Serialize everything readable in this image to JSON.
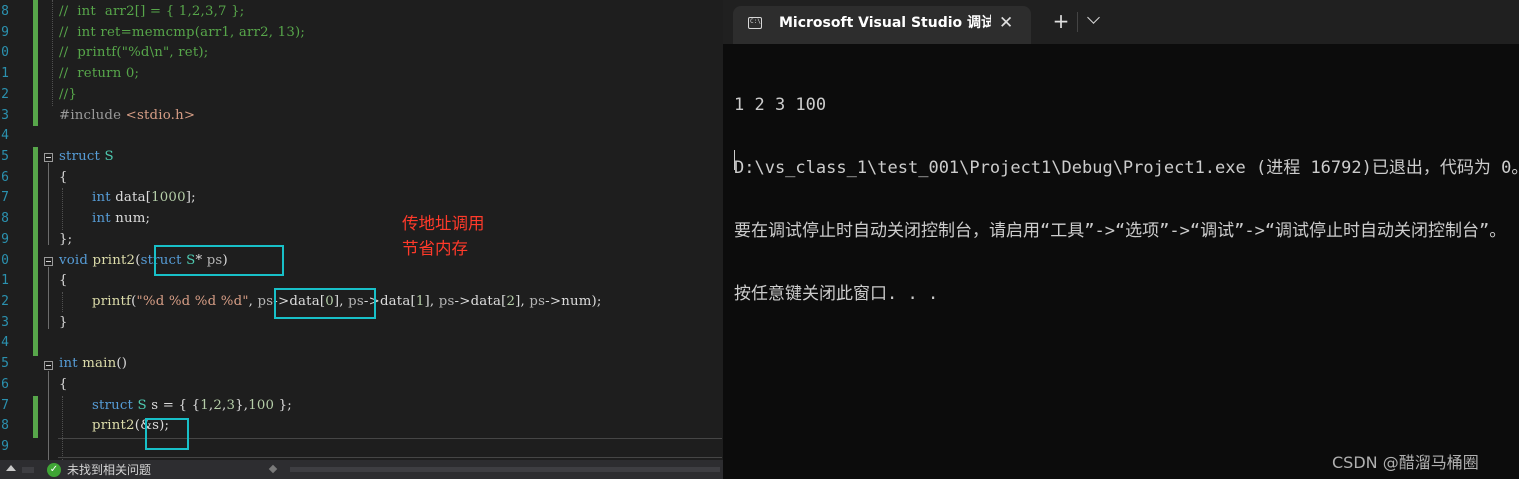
{
  "editor": {
    "line_numbers": [
      "8",
      "9",
      "0",
      "1",
      "2",
      "3",
      "4",
      "5",
      "6",
      "7",
      "8",
      "9",
      "0",
      "1",
      "2",
      "3",
      "4",
      "5",
      "6",
      "7",
      "8",
      "9"
    ],
    "lines": {
      "l0": {
        "a": "//  int  arr2[] = { 1,2,3,7 };"
      },
      "l1": {
        "a": "//  int ret=memcmp(arr1, arr2, 13);"
      },
      "l2": {
        "a": "//  printf(\"%d\\n\", ret);"
      },
      "l3": {
        "a": "//  return 0;"
      },
      "l4": {
        "a": "//}"
      },
      "l5": {
        "a": "#include ",
        "b": "<stdio.h>"
      },
      "l7": {
        "a": "struct ",
        "b": "S"
      },
      "l8": {
        "a": "{"
      },
      "l9": {
        "a": "int ",
        "b": "data",
        "c": "[",
        "d": "1000",
        "e": "];"
      },
      "l10": {
        "a": "int ",
        "b": "num",
        ";": ";"
      },
      "l11": {
        "a": "};"
      },
      "l12": {
        "a": "void ",
        "b": "print2",
        "c": "(",
        "d": "struct ",
        "e": "S",
        "f": "* ",
        "g": "ps",
        ")": ")"
      },
      "l13": {
        "a": "{"
      },
      "l14": {
        "a": "printf",
        "b": "(",
        "c": "\"%d %d %d %d\"",
        ",": ", ",
        "d": "ps",
        "e": "->",
        "f": "data",
        "g": "[",
        "h": "0",
        "i": "], ",
        "j": "ps",
        "k": "->",
        "l": "data",
        "m": "[",
        "n": "1",
        "o": "], ",
        "p": "ps",
        "q": "->",
        "r": "data",
        "s": "[",
        "t": "2",
        "u": "], ",
        "v": "ps",
        "w": "->",
        "x": "num",
        "y": ");"
      },
      "l15": {
        "a": "}"
      },
      "l17": {
        "a": "int ",
        "b": "main",
        "c": "()"
      },
      "l18": {
        "a": "{"
      },
      "l19": {
        "a": "struct ",
        "b": "S ",
        "c": "s",
        " =": " = { {",
        "d": "1",
        ",1": ",",
        "e": "2",
        ",2": ",",
        "f": "3",
        "g": "},",
        "h": "100",
        "i": " };"
      },
      "l20": {
        "a": "print2",
        "b": "(",
        "c": "&s",
        "d": ");"
      }
    },
    "annotation_line1": "传地址调用",
    "annotation_line2": "节省内存",
    "status_text": "未找到相关问题"
  },
  "terminal": {
    "tab_title": "Microsoft Visual Studio 调试控制台",
    "tab_close": "✕",
    "new_tab": "+",
    "lines": [
      "1 2 3 100",
      "D:\\vs_class_1\\test_001\\Project1\\Debug\\Project1.exe (进程 16792)已退出，代码为 0。",
      "要在调试停止时自动关闭控制台，请启用“工具”->“选项”->“调试”->“调试停止时自动关闭控制台”。",
      "按任意键关闭此窗口. . ."
    ]
  },
  "watermark": "CSDN @醋溜马桶圈",
  "colors": {
    "comment": "#57a64a",
    "keyword": "#569cd6",
    "type": "#4ec9b0",
    "function": "#dcdcaa",
    "string": "#d69d85",
    "highlight_box": "#18c0c8",
    "annotation": "#ff3a2a"
  }
}
